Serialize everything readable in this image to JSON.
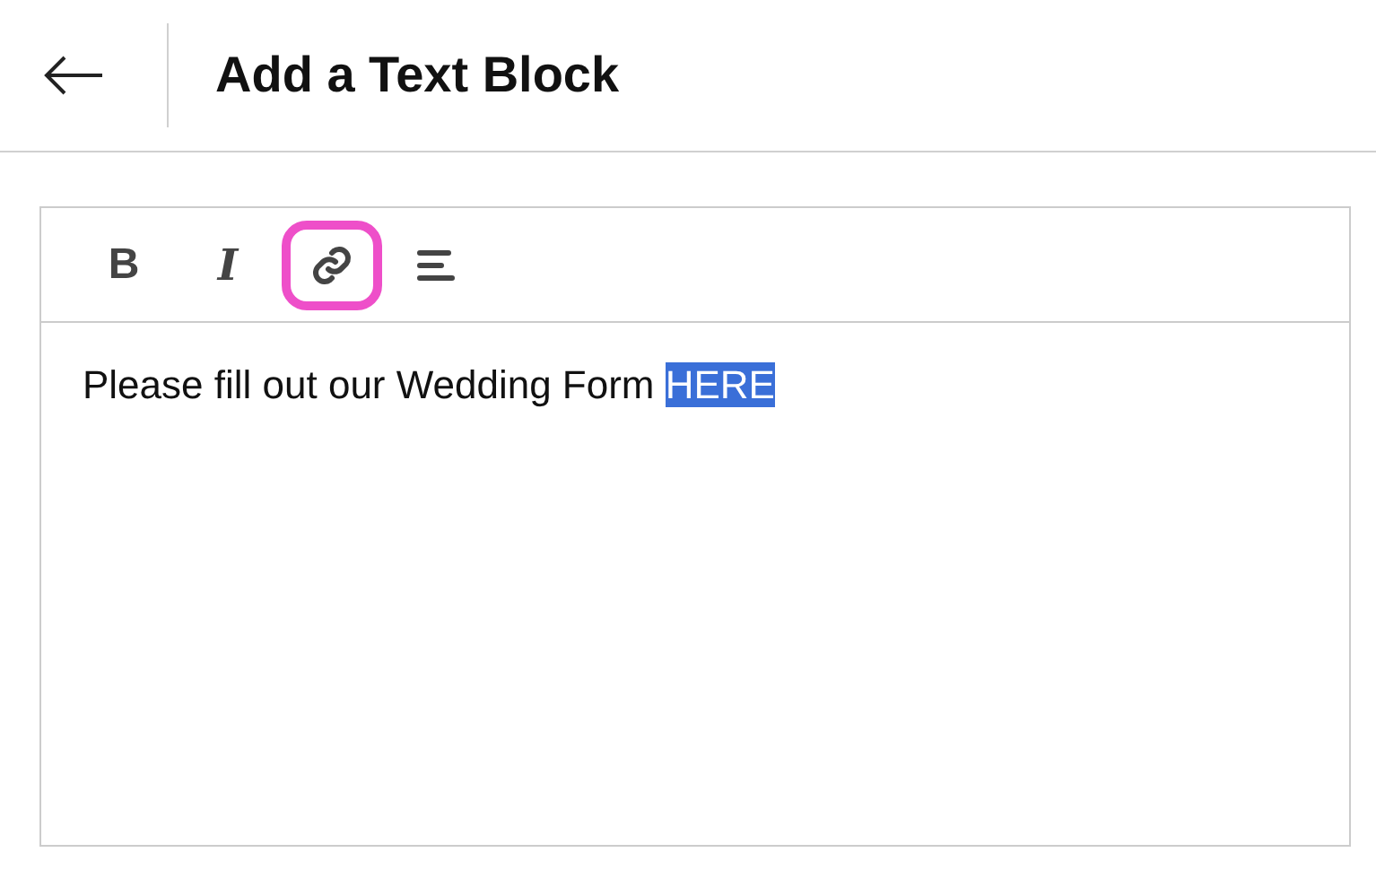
{
  "header": {
    "title": "Add a Text Block"
  },
  "toolbar": [
    {
      "kind": "bold",
      "label": "B",
      "highlighted": false
    },
    {
      "kind": "italic",
      "label": "I",
      "highlighted": false
    },
    {
      "kind": "link",
      "highlighted": true
    },
    {
      "kind": "align",
      "highlighted": false
    }
  ],
  "editor": {
    "segments": [
      {
        "text": "Please fill out our Wedding Form ",
        "selected": false
      },
      {
        "text": "HERE",
        "selected": true
      }
    ]
  }
}
